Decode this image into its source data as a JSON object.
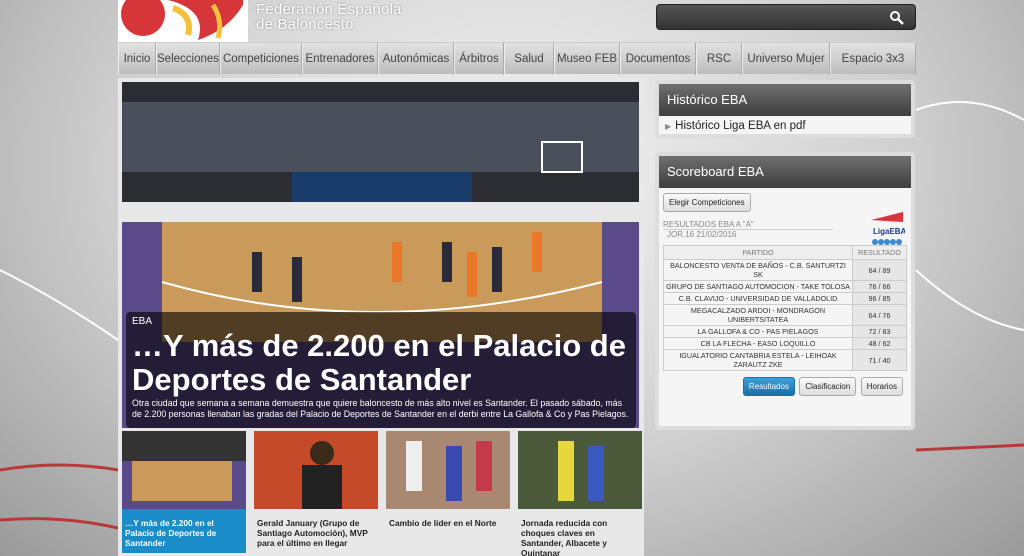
{
  "brand": {
    "line1": "Federación Española",
    "line2": "de Baloncesto"
  },
  "nav": [
    "Inicio",
    "Selecciones",
    "Competiciones",
    "Entrenadores",
    "Autonómicas",
    "Árbitros",
    "Salud",
    "Museo FEB",
    "Documentos",
    "RSC",
    "Universo Mujer",
    "Espacio 3x3"
  ],
  "hero": {
    "category": "EBA",
    "title": "…Y más de 2.200 en el Palacio de Deportes de Santander",
    "text": "Otra ciudad que semana a semana demuestra que quiere baloncesto de más alto nivel es Santander. El pasado sábado, más de 2.200 personas llenaban las gradas del Palacio de Deportes de Santander en el derbi entre La Gallofa & Co y Pas Pielagos."
  },
  "thumbs": [
    {
      "label": "…Y más de 2.200 en el Palacio de Deportes de Santander"
    },
    {
      "label": "Gerald January (Grupo de Santiago Automoción), MVP para el último en llegar"
    },
    {
      "label": "Cambio de líder en el Norte"
    },
    {
      "label": "Jornada reducida con choques claves en Santander, Albacete y Quintanar"
    }
  ],
  "historico": {
    "title": "Histórico EBA",
    "link": "Histórico Liga EBA en pdf"
  },
  "scoreboard": {
    "title": "Scoreboard EBA",
    "choose_btn": "Elegir Competiciones",
    "results_title": "RESULTADOS EBA A \"A\"",
    "jornada": "JOR.16 21/02/2016",
    "logo_text": "LigaEBA",
    "col_match": "PARTIDO",
    "col_result": "RESULTADO",
    "rows": [
      {
        "match": "BALONCESTO VENTA DE BAÑOS - C.B. SANTURTZI SK",
        "result": "64 / 89"
      },
      {
        "match": "GRUPO DE SANTIAGO AUTOMOCION - TAKE TOLOSA",
        "result": "76 / 66"
      },
      {
        "match": "C.B. CLAVIJO - UNIVERSIDAD DE VALLADOLID",
        "result": "96 / 85"
      },
      {
        "match": "MEGACALZADO ARDOI - MONDRAGON UNIBERTSITATEA",
        "result": "64 / 76"
      },
      {
        "match": "LA GALLOFA & CO - PAS PIELAGOS",
        "result": "72 / 83"
      },
      {
        "match": "CB LA FLECHA - EASO LOQUILLO",
        "result": "48 / 62"
      },
      {
        "match": "IGUALATORIO CANTABRIA ESTELA - LEIHOAK ZARAUTZ ZKE",
        "result": "71 / 40"
      }
    ],
    "buttons": [
      "Resultados",
      "Clasificacion",
      "Horarios"
    ]
  }
}
